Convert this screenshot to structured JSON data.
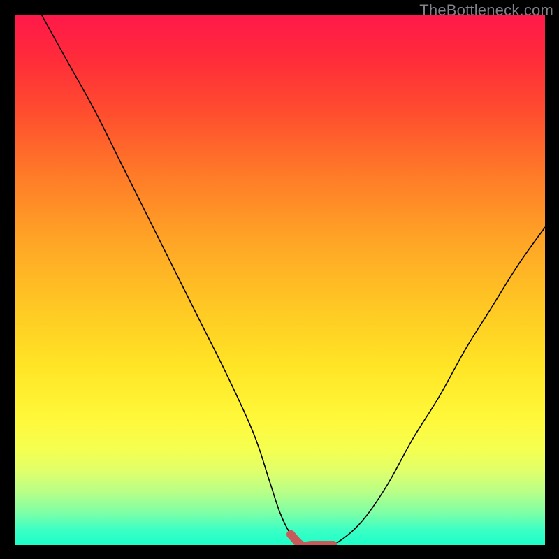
{
  "watermark": "TheBottleneck.com",
  "colors": {
    "frame": "#000000",
    "curve": "#000000",
    "highlight": "#c85a5a",
    "gradient_top": "#ff194a",
    "gradient_bottom": "#1affc9"
  },
  "chart_data": {
    "type": "line",
    "title": "",
    "xlabel": "",
    "ylabel": "",
    "xlim": [
      0,
      100
    ],
    "ylim": [
      0,
      100
    ],
    "x": [
      5,
      10,
      15,
      20,
      25,
      30,
      35,
      40,
      45,
      48,
      50,
      52,
      54,
      56,
      58,
      60,
      65,
      70,
      75,
      80,
      85,
      90,
      95,
      100
    ],
    "values": [
      100,
      91,
      82,
      72,
      62,
      52,
      42,
      32,
      21,
      12,
      6,
      2,
      0,
      0,
      0,
      0,
      4,
      11,
      20,
      28,
      37,
      45,
      53,
      60
    ],
    "curve_description": "V-shaped bottleneck curve: steep descent from top-left reaching a flat minimum around x=53-60, then a gentler ascent toward the right edge.",
    "highlight_segment": {
      "x_start": 52,
      "x_end": 60,
      "note": "Flat bottom region highlighted in thick red, optimal zone."
    },
    "annotations": [],
    "legend": null
  }
}
